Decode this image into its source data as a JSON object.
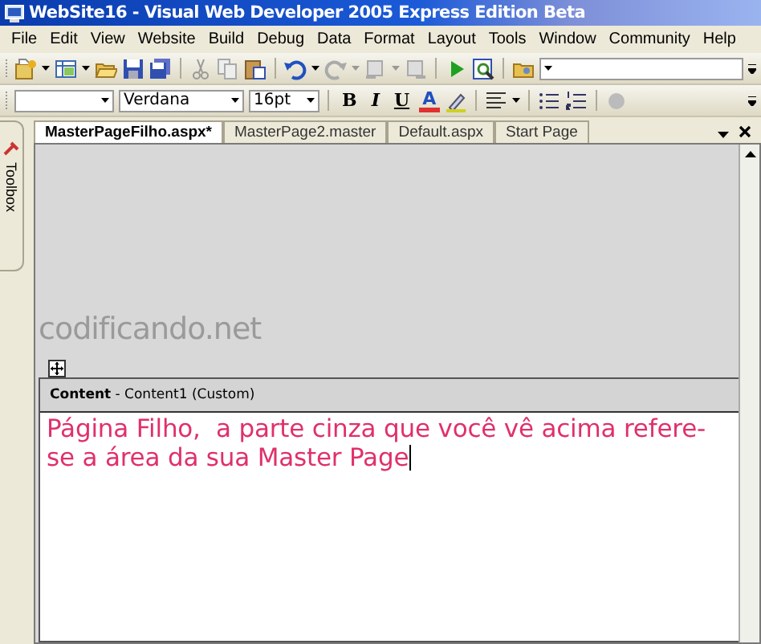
{
  "window": {
    "title": "WebSite16 - Visual Web Developer 2005 Express Edition Beta"
  },
  "menu": [
    "File",
    "Edit",
    "View",
    "Website",
    "Build",
    "Debug",
    "Data",
    "Format",
    "Layout",
    "Tools",
    "Window",
    "Community",
    "Help"
  ],
  "format_bar": {
    "font": {
      "value": "Verdana"
    },
    "size": {
      "value": "16pt"
    },
    "buttons": [
      {
        "label": "B",
        "kind": "bold"
      },
      {
        "label": "I",
        "kind": "italic"
      },
      {
        "label": "U",
        "kind": "underline"
      },
      {
        "label": "A",
        "kind": "color"
      }
    ]
  },
  "tabs": [
    {
      "label": "MasterPageFilho.aspx*",
      "selected": true
    },
    {
      "label": "MasterPage2.master",
      "selected": false
    },
    {
      "label": "Default.aspx",
      "selected": false
    },
    {
      "label": "Start Page",
      "selected": false
    }
  ],
  "toolbox": {
    "label": "Toolbox"
  },
  "master_area": {
    "logo": "codificando.net"
  },
  "content_region": {
    "header": "**Content** - Content1 (Custom)",
    "text": "Página Filho,  a parte cinza que você vê acima refere-se a área da sua Master Page"
  }
}
